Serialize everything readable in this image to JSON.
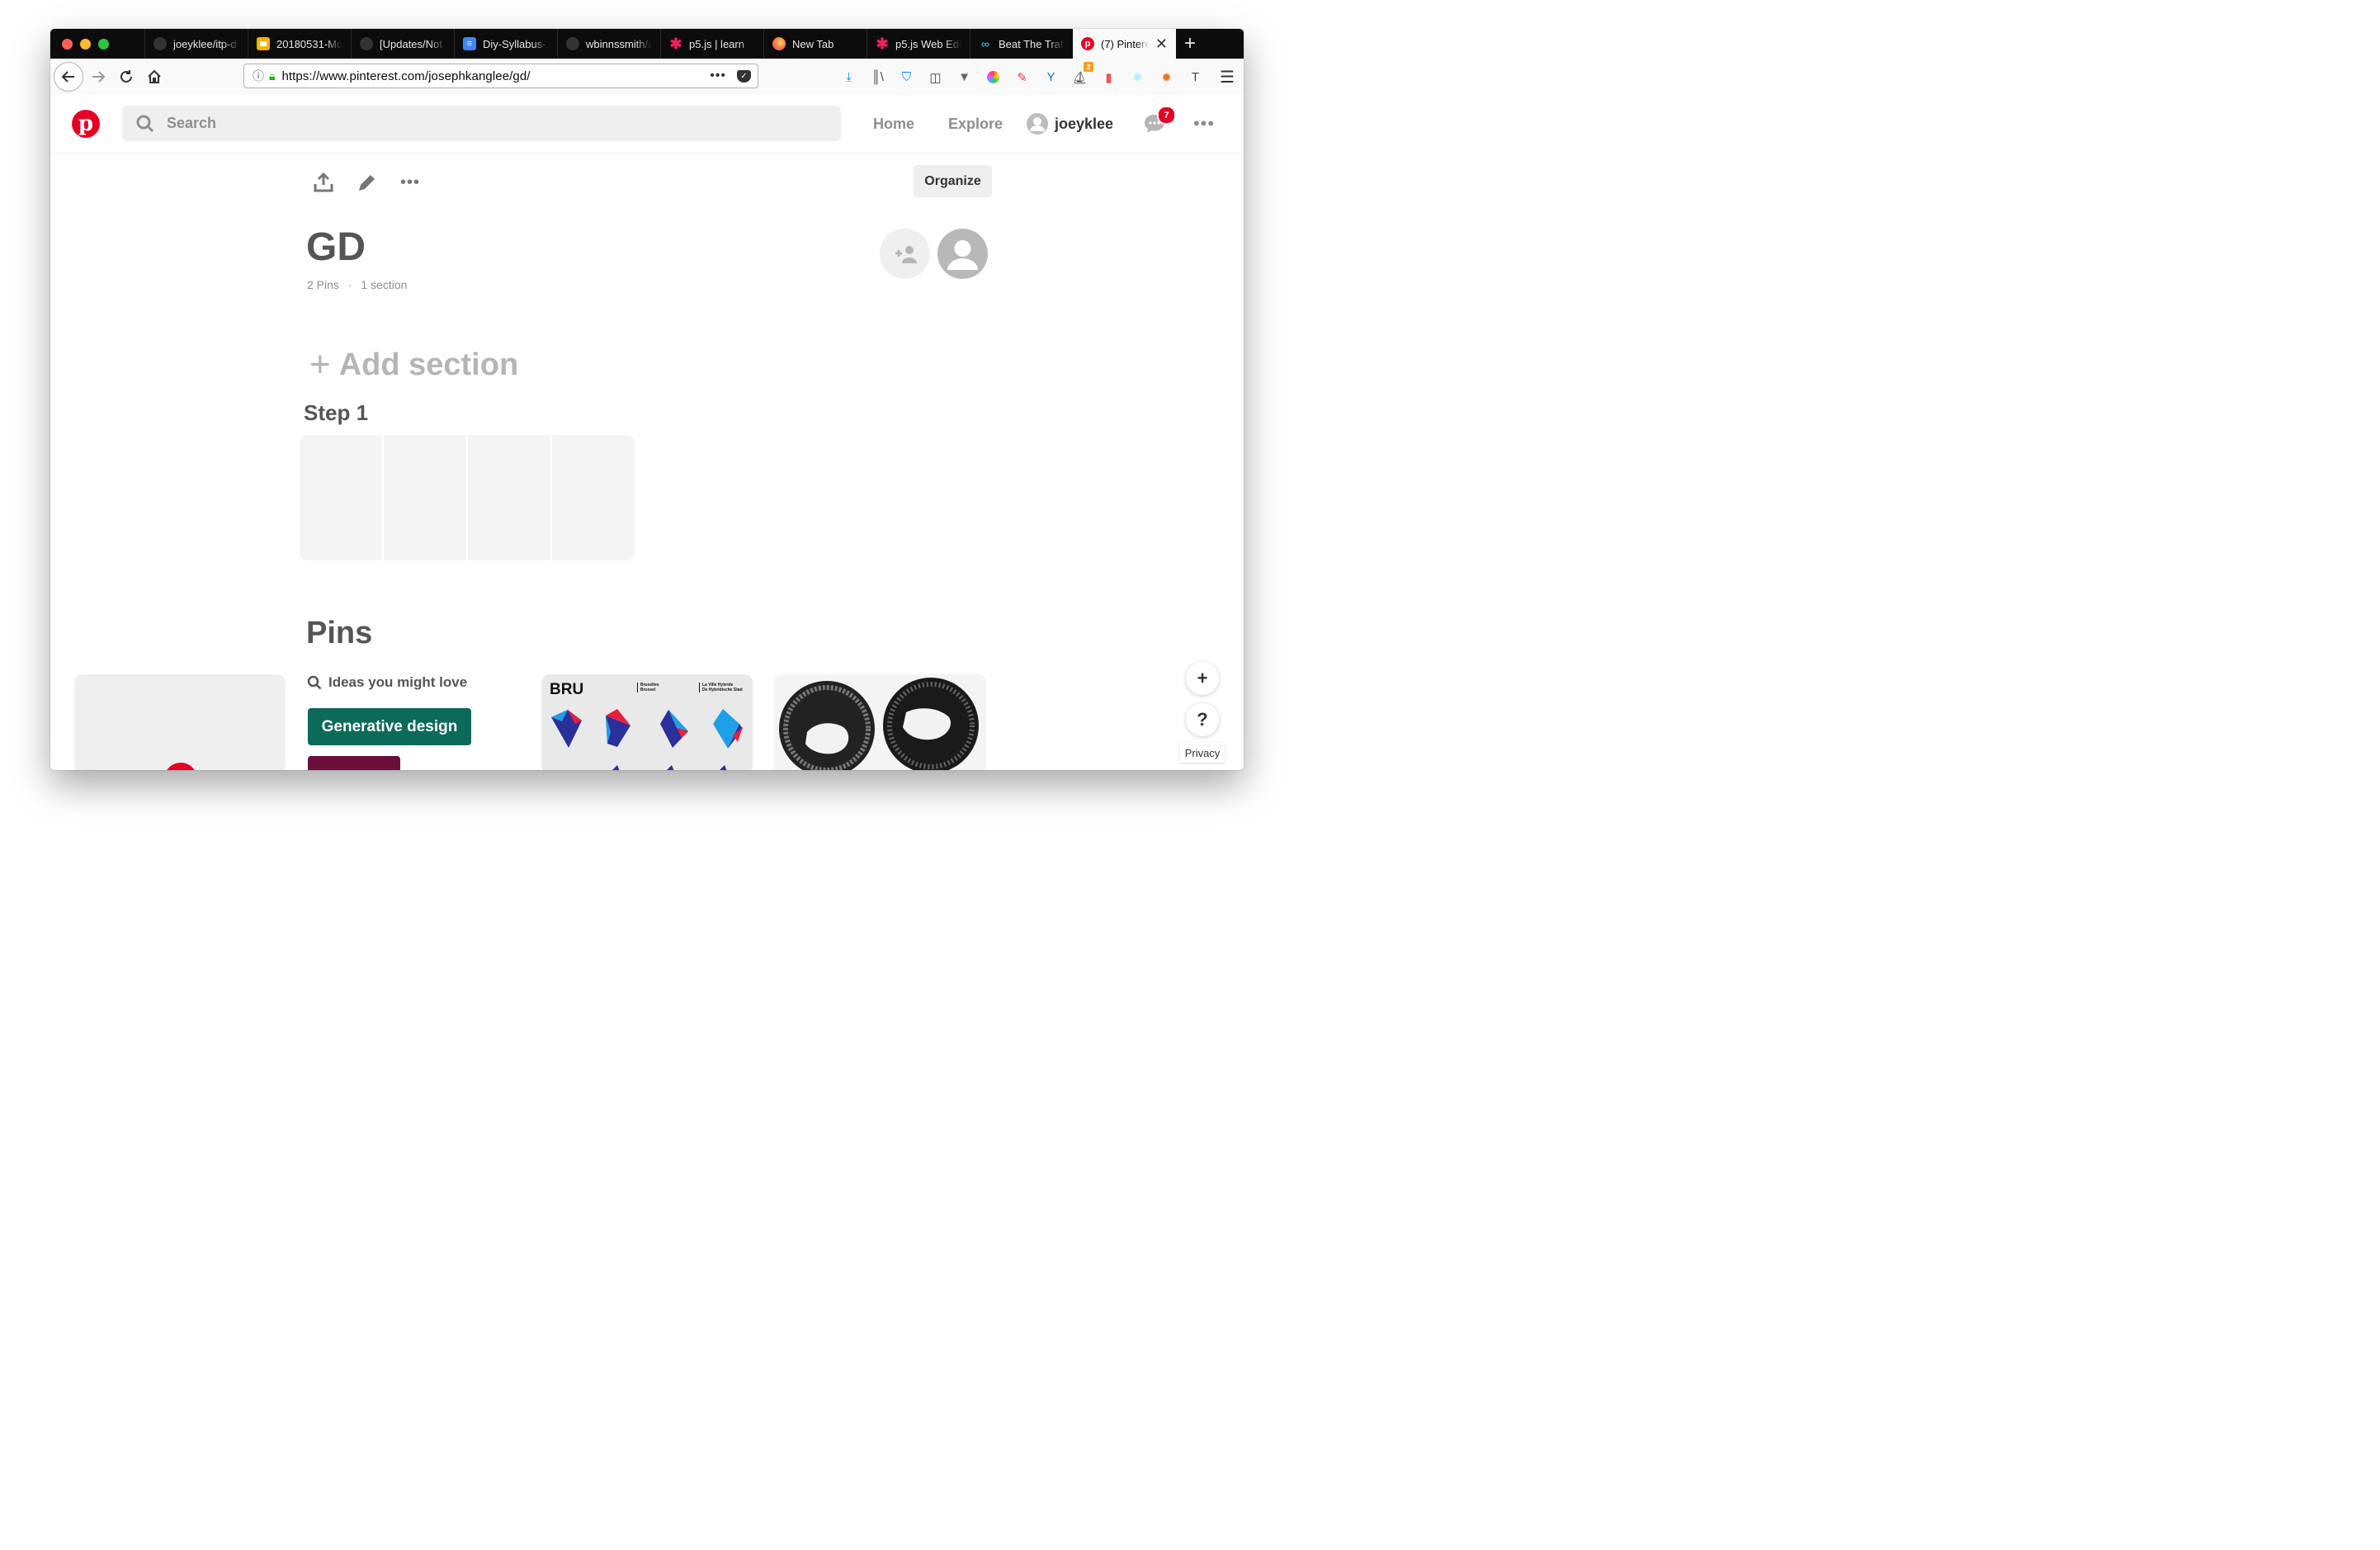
{
  "browser": {
    "tabs": [
      {
        "label": "joeyklee/itp-d",
        "icon": "github-icon"
      },
      {
        "label": "20180531-Mo",
        "icon": "slides-icon"
      },
      {
        "label": "[Updates/Not",
        "icon": "github-icon"
      },
      {
        "label": "Diy-Syllabus-",
        "icon": "docs-icon"
      },
      {
        "label": "wbinnssmith/a",
        "icon": "github-icon"
      },
      {
        "label": "p5.js | learn",
        "icon": "p5-icon"
      },
      {
        "label": "New Tab",
        "icon": "firefox-icon"
      },
      {
        "label": "p5.js Web Edi",
        "icon": "p5-icon"
      },
      {
        "label": "Beat The Traf",
        "icon": "link-icon"
      },
      {
        "label": "(7) Pintere",
        "icon": "pinterest-icon",
        "active": true
      }
    ],
    "url": "https://www.pinterest.com/josephkanglee/gd/",
    "toolbar_badge": "2"
  },
  "header": {
    "search_placeholder": "Search",
    "nav": {
      "home": "Home",
      "explore": "Explore",
      "username": "joeyklee"
    },
    "notification_count": "7"
  },
  "board": {
    "organize_label": "Organize",
    "title": "GD",
    "pins_count": "2 Pins",
    "sections_count": "1 section",
    "add_section_label": "Add section",
    "section_name": "Step 1",
    "pins_heading": "Pins"
  },
  "ideas": {
    "label": "Ideas you might love",
    "chips": [
      {
        "label": "Generative design",
        "color": "#0b6b58"
      },
      {
        "label": "",
        "color": "#6b0f3a"
      }
    ]
  },
  "pins": [
    {
      "title_text": "BRU",
      "caption_1": "Bruxelles\nBrussel",
      "caption_2": "La Ville Hybride\nDe Hybridische Stad"
    }
  ],
  "help": {
    "privacy_label": "Privacy",
    "help_label": "?"
  },
  "colors": {
    "pinterest_red": "#e60023",
    "text_gray": "#8e8e8e"
  }
}
